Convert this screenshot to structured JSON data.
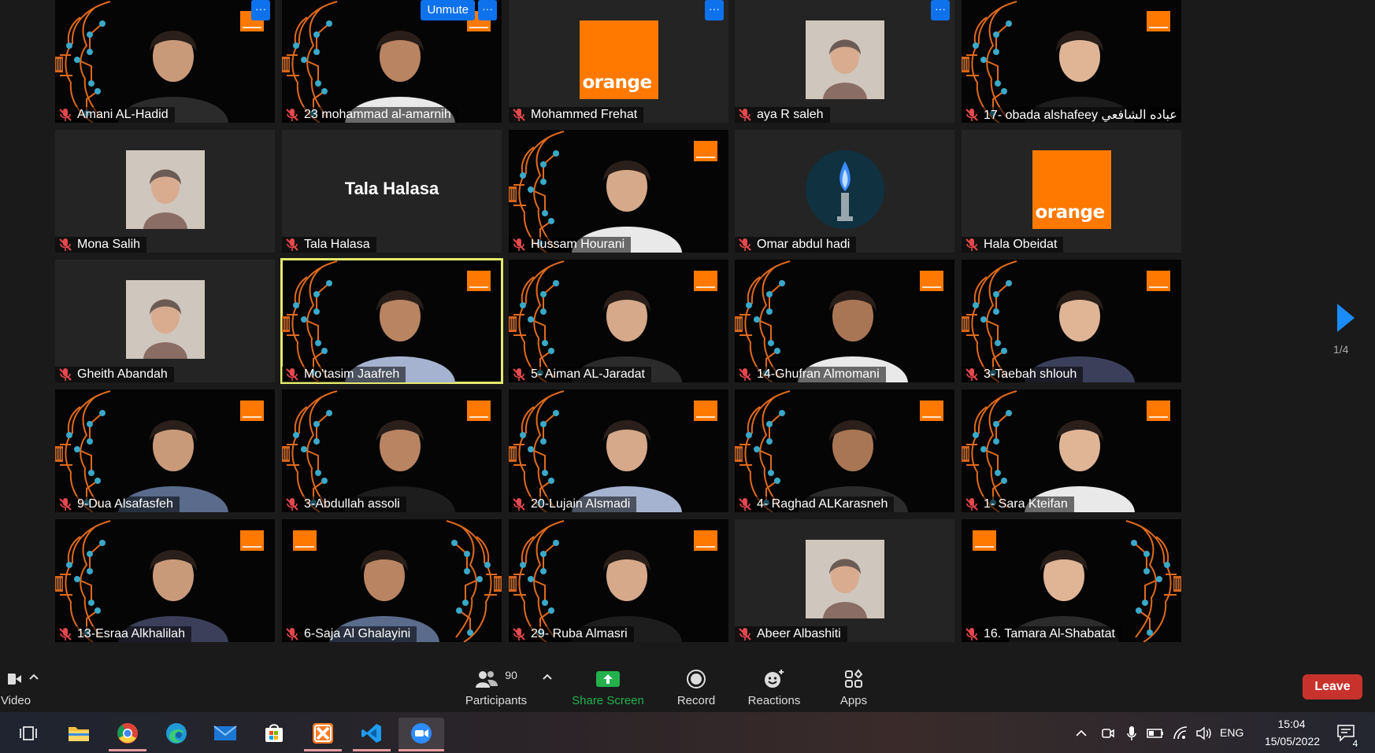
{
  "participants": [
    {
      "name": "Amani AL-Hadid",
      "type": "video",
      "more": true
    },
    {
      "name": "23 mohammad al-amarnih",
      "type": "video",
      "more": true,
      "unmute": true
    },
    {
      "name": "Mohammed Frehat",
      "type": "orange",
      "more": true
    },
    {
      "name": "aya R saleh",
      "type": "photo",
      "more": true
    },
    {
      "name": "17- obada alshafeey عباده الشافعي",
      "type": "video"
    },
    {
      "name": "Mona Salih",
      "type": "photo"
    },
    {
      "name": "Tala Halasa",
      "type": "text",
      "display_text": "Tala Halasa"
    },
    {
      "name": "Hussam Hourani",
      "type": "video"
    },
    {
      "name": "Omar abdul hadi",
      "type": "circle"
    },
    {
      "name": "Hala Obeidat",
      "type": "orange"
    },
    {
      "name": "Gheith Abandah",
      "type": "photo"
    },
    {
      "name": "Mo'tasim Jaafreh",
      "type": "video",
      "active": true
    },
    {
      "name": "5- Aiman AL-Jaradat",
      "type": "video"
    },
    {
      "name": "14-Ghufran Almomani",
      "type": "video"
    },
    {
      "name": "3-Taebah shlouh",
      "type": "video"
    },
    {
      "name": "9-Dua Alsafasfeh",
      "type": "video"
    },
    {
      "name": "3-Abdullah assoli",
      "type": "video"
    },
    {
      "name": "20-Lujain Alsmadi",
      "type": "video"
    },
    {
      "name": "4- Raghad ALKarasneh",
      "type": "video"
    },
    {
      "name": "1- Sara Kteifan",
      "type": "video"
    },
    {
      "name": "13-Esraa Alkhalilah",
      "type": "video"
    },
    {
      "name": "6-Saja Al Ghalayini",
      "type": "video",
      "mirrored": true
    },
    {
      "name": "29- Ruba Almasri",
      "type": "video"
    },
    {
      "name": "Abeer Albashiti",
      "type": "photo"
    },
    {
      "name": "16. Tamara Al-Shabatat",
      "type": "video",
      "mirrored": true
    }
  ],
  "orange_logo_text": "orange",
  "unmute_label": "Unmute",
  "more_label": "···",
  "pager": {
    "label": "1/4"
  },
  "toolbar": {
    "video_label": "Video",
    "participants_label": "Participants",
    "participants_count": "90",
    "share_label": "Share Screen",
    "record_label": "Record",
    "reactions_label": "Reactions",
    "apps_label": "Apps",
    "leave_label": "Leave"
  },
  "taskbar": {
    "language": "ENG",
    "time": "15:04",
    "date": "15/05/2022",
    "notification_count": "4"
  },
  "colors": {
    "orange": "#ff7900",
    "accent_blue": "#0e72ed",
    "leave_red": "#c8322c",
    "active_border": "#e4ea6c",
    "share_green": "#23b14d"
  }
}
